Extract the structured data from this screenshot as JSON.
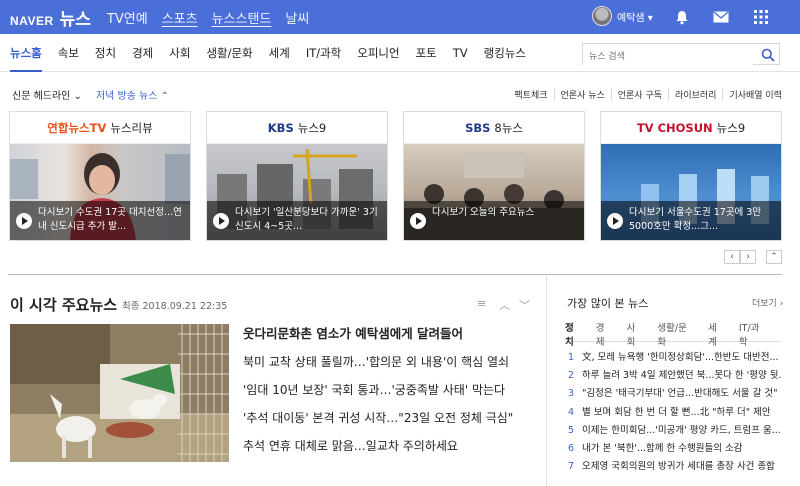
{
  "header": {
    "logo_naver": "NAVER",
    "logo_news": "뉴스",
    "nav": [
      "TV연예",
      "스포츠",
      "뉴스스탠드",
      "날씨"
    ],
    "username": "예탁샘 ▾"
  },
  "sections": [
    "뉴스홈",
    "속보",
    "정치",
    "경제",
    "사회",
    "생활/문화",
    "세계",
    "IT/과학",
    "오피니언",
    "포토",
    "TV",
    "랭킹뉴스"
  ],
  "search": {
    "placeholder": "뉴스 검색"
  },
  "subbar": {
    "tab1": "신문 헤드라인 ⌄",
    "tab2": "저녁 방송 뉴스 ⌃",
    "links": [
      "팩트체크",
      "언론사 뉴스",
      "언론사 구독",
      "라이브러리",
      "기사배열 이력"
    ]
  },
  "cards": [
    {
      "brand": "연합뉴스TV",
      "program": "뉴스리뷰",
      "caption": "다시보기 수도권 17곳 대지선정...연내 신도시급 추가 발..."
    },
    {
      "brand": "KBS",
      "program": "뉴스9",
      "caption": "다시보기 '일산분당보다 가까운' 3기 신도시 4~5곳..."
    },
    {
      "brand": "SBS",
      "program": "8뉴스",
      "caption": "다시보기 오늘의 주요뉴스"
    },
    {
      "brand": "TV CHOSUN",
      "program": "뉴스9",
      "caption": "다시보기 서울수도권 17곳에 3만5000호만 확정...그..."
    }
  ],
  "main": {
    "title": "이 시각 주요뉴스",
    "time": "최종 2018.09.21 22:35",
    "headlines": [
      "웃다리문화촌 염소가 예탁샘에게 달려들어",
      "북미 교착 상태 풀릴까…'합의문 외 내용'이 핵심 열쇠",
      "'임대 10년 보장' 국회 통과…'궁중족발 사태' 막는다",
      "'추석 대이동' 본격 귀성 시작…\"23일 오전 정체 극심\"",
      "추석 연휴 대체로 맑음…일교차 주의하세요"
    ]
  },
  "popular": {
    "title": "가장 많이 본 뉴스",
    "more": "더보기 ›",
    "tabs": [
      "정치",
      "경제",
      "사회",
      "생활/문화",
      "세계",
      "IT/과학"
    ],
    "items": [
      {
        "n": "1",
        "t": "文, 모레 뉴욕행 '한미정상회담'...한반도 대반전..."
      },
      {
        "n": "2",
        "t": "하루 늘려 3박 4일 제안했던 북...못다 한 '평양 뒷..."
      },
      {
        "n": "3",
        "t": "\"김정은 '태극기부대' 언급...반대해도 서울 갈 것\""
      },
      {
        "n": "4",
        "t": "별 보며 회담 한 번 더 할 뻔...北 \"하루 더\" 제안"
      },
      {
        "n": "5",
        "t": "이제는 한미회담...'미공개' 평양 카드, 트럼프 움..."
      },
      {
        "n": "6",
        "t": "내가 본 '북한'...함께 한 수행원들의 소감"
      },
      {
        "n": "7",
        "t": "오제영 국회의원의 방귀가 세대를 총장 사건 종합"
      }
    ]
  },
  "colors": {
    "brand": "#4a6fd9",
    "accent": "#3a5fcd"
  }
}
